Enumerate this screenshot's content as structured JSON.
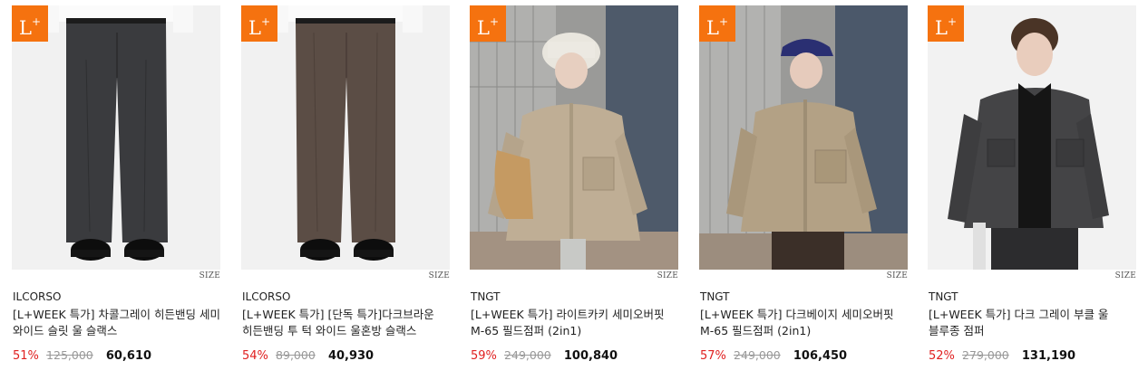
{
  "badge": {
    "text": "L",
    "sup": "+",
    "color": "#f5720f"
  },
  "size_label": "SIZE",
  "products": [
    {
      "brand": "ILCORSO",
      "title": "[L+WEEK 특가] 차콜그레이 히든밴딩 세미 와이드 슬릿 울 슬랙스",
      "discount": "51%",
      "original_price": "125,000",
      "sale_price": "60,610",
      "image": "charcoal-wide-slacks"
    },
    {
      "brand": "ILCORSO",
      "title": "[L+WEEK 특가] [단독 특가]다크브라운 히든밴딩 투 턱 와이드 울혼방 슬랙스",
      "discount": "54%",
      "original_price": "89,000",
      "sale_price": "40,930",
      "image": "brown-tuck-slacks"
    },
    {
      "brand": "TNGT",
      "title": "[L+WEEK 특가] 라이트카키 세미오버핏 M-65 필드점퍼 (2in1)",
      "discount": "59%",
      "original_price": "249,000",
      "sale_price": "100,840",
      "image": "light-khaki-field-jacket"
    },
    {
      "brand": "TNGT",
      "title": "[L+WEEK 특가] 다크베이지 세미오버핏 M-65 필드점퍼 (2in1)",
      "discount": "57%",
      "original_price": "249,000",
      "sale_price": "106,450",
      "image": "dark-beige-field-jacket"
    },
    {
      "brand": "TNGT",
      "title": "[L+WEEK 특가] 다크 그레이 부클 울 블루종 점퍼",
      "discount": "52%",
      "original_price": "279,000",
      "sale_price": "131,190",
      "image": "grey-boucle-blouson"
    }
  ]
}
